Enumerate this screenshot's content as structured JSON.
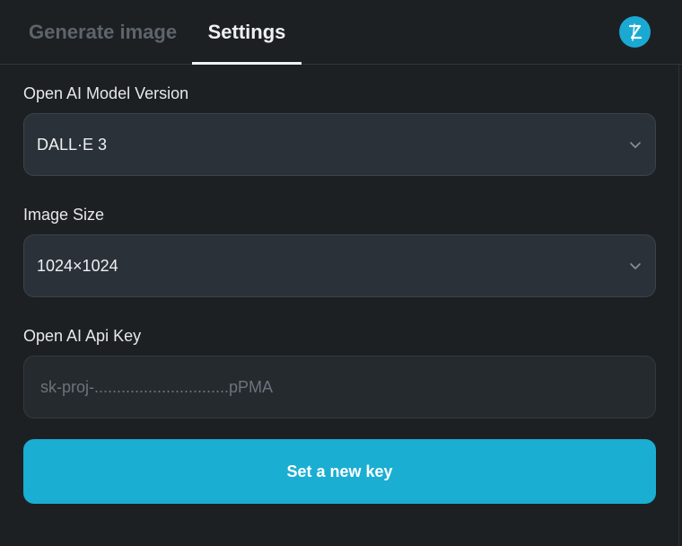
{
  "tabs": [
    {
      "label": "Generate image",
      "active": false
    },
    {
      "label": "Settings",
      "active": true
    }
  ],
  "logo": {
    "icon": "z-logo-icon",
    "color": "#1aa9d2"
  },
  "settings": {
    "model": {
      "label": "Open AI Model Version",
      "value": "DALL·E 3"
    },
    "size": {
      "label": "Image Size",
      "value": "1024×1024"
    },
    "api_key": {
      "label": "Open AI Api Key",
      "value": "",
      "placeholder": "sk-proj-..............................pPMA"
    }
  },
  "actions": {
    "set_key_label": "Set a new key"
  },
  "colors": {
    "accent": "#1aaed2",
    "background": "#1d2023",
    "field": "#2b3138"
  }
}
